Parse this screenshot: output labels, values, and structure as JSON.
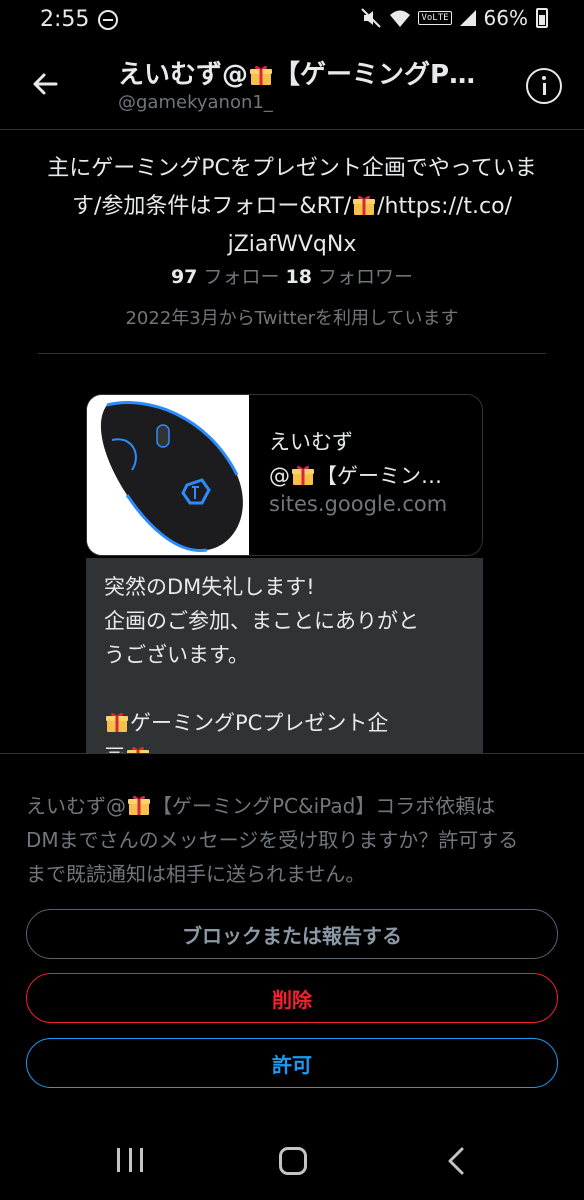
{
  "status_bar": {
    "time": "2:55",
    "battery": "66%",
    "volte": "VoLTE"
  },
  "header": {
    "title_pre": "えいむず@",
    "title_post": "【ゲーミングP…",
    "handle": "@gamekyanon1_"
  },
  "profile": {
    "bio_line1": "主にゲーミングPCをプレゼント企画でやっていま",
    "bio_line2_pre": "す/参加条件はフォロー&RT/",
    "bio_line2_post": "/https://t.co/",
    "bio_line3": "jZiafWVqNx",
    "following_count": "97",
    "following_label": "フォロー",
    "followers_count": "18",
    "followers_label": "フォロワー",
    "joined": "2022年3月からTwitterを利用しています"
  },
  "link_card": {
    "title_line1": "えいむず",
    "title_line2_pre": "@",
    "title_line2_post": "【ゲーミン…",
    "domain": "sites.google.com"
  },
  "message": {
    "line1": "突然のDM失礼します!",
    "line2": "企画のご参加、まことにありがと",
    "line3": "うございます。",
    "line4_post": "ゲーミングPCプレゼント企",
    "line5_pre": "画"
  },
  "request_sheet": {
    "text_pre": "えいむず@",
    "text_post": "【ゲーミングPC&iPad】コラボ依頼は",
    "text_line2": "DMまでさんのメッセージを受け取りますか？許可する",
    "text_line3": "まで既読通知は相手に送られません。",
    "block_button": "ブロックまたは報告する",
    "delete_button": "削除",
    "allow_button": "許可"
  },
  "colors": {
    "background": "#000000",
    "accent_blue": "#1d9bf0",
    "danger_red": "#f4212e",
    "secondary_text": "#71767b"
  },
  "icons": [
    "back-arrow-icon",
    "info-icon",
    "gift-icon",
    "dnd-icon",
    "mute-icon",
    "wifi-icon",
    "signal-icon",
    "battery-icon",
    "recents-icon",
    "home-icon",
    "nav-back-icon"
  ]
}
